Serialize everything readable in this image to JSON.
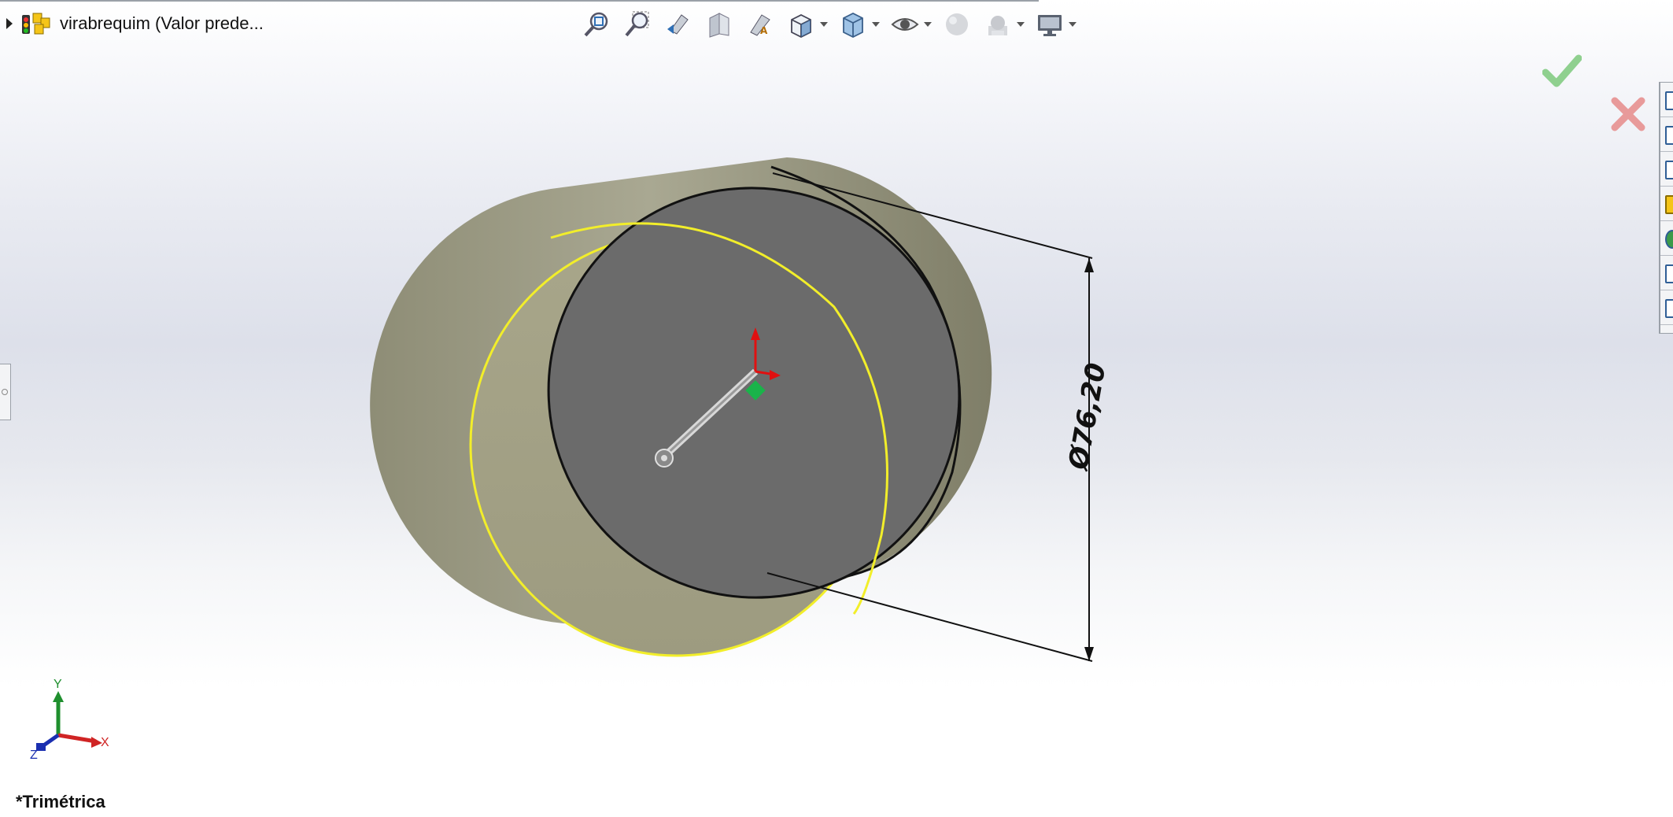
{
  "feature_tree": {
    "expand_icon": "expand-arrow-icon",
    "root_icon": "assembly-icon",
    "root_label": "virabrequim  (Valor prede..."
  },
  "view_toolbar": {
    "buttons": [
      {
        "name": "zoom-to-fit-icon"
      },
      {
        "name": "zoom-to-area-icon"
      },
      {
        "name": "previous-view-icon"
      },
      {
        "name": "section-view-icon"
      },
      {
        "name": "dynamic-annotation-views-icon"
      },
      {
        "name": "view-orientation-icon",
        "dropdown": true
      },
      {
        "name": "display-style-icon",
        "dropdown": true
      },
      {
        "name": "hide-show-items-icon",
        "dropdown": true
      },
      {
        "name": "edit-appearance-icon"
      },
      {
        "name": "apply-scene-icon",
        "dropdown": true
      },
      {
        "name": "view-settings-icon",
        "dropdown": true
      }
    ]
  },
  "confirmation_corner": {
    "ok_icon": "check-icon",
    "cancel_icon": "close-icon",
    "ok_color": "#8fd08f",
    "cancel_color": "#e89a9a"
  },
  "task_pane": {
    "tabs": [
      "home-icon",
      "resources-icon",
      "design-library-icon",
      "file-explorer-icon",
      "appearances-icon",
      "custom-properties-icon",
      "forum-icon"
    ]
  },
  "dimension": {
    "label": "Ø76,20",
    "value": 76.2,
    "unit_hint": "diameter"
  },
  "model": {
    "face_color": "#6a6a6a",
    "body_color": "#a3a28a",
    "highlight_color": "#f2ee2a"
  },
  "triad": {
    "x_label": "X",
    "y_label": "Y",
    "z_label": "Z"
  },
  "view_name": "*Trimétrica"
}
